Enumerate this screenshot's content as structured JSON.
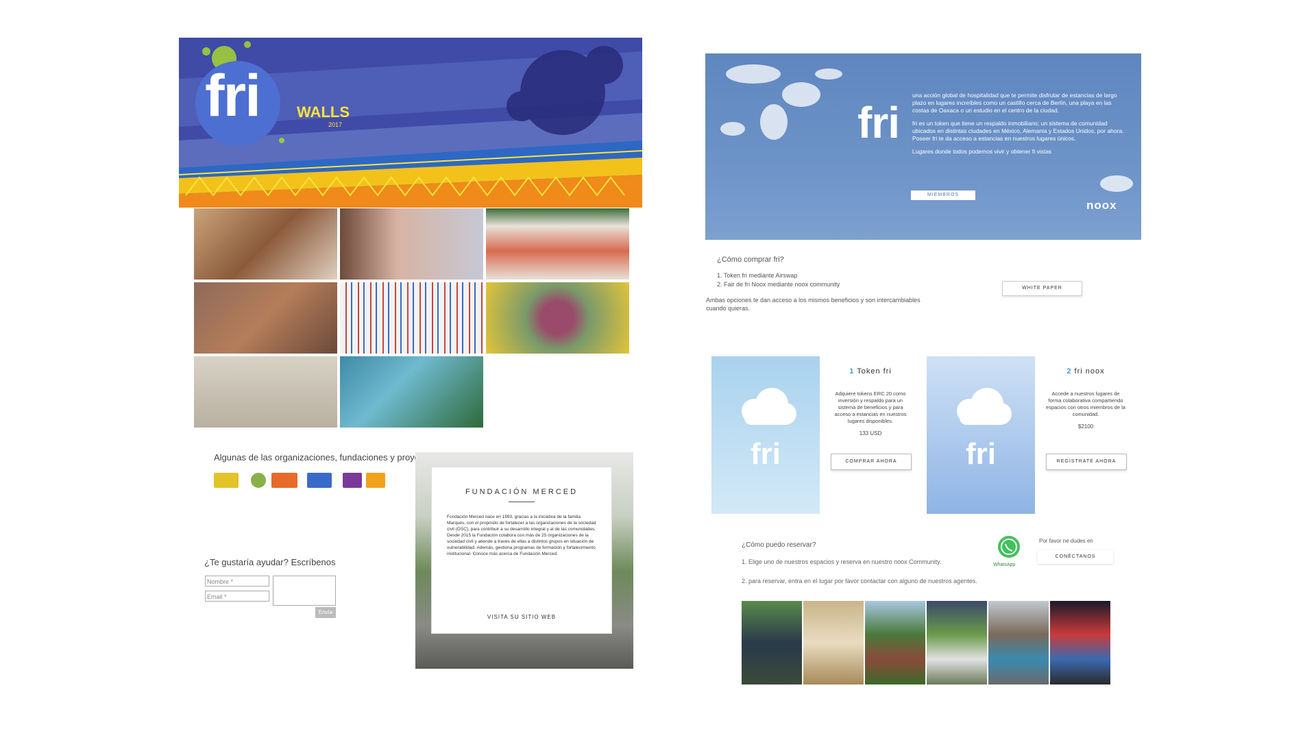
{
  "left": {
    "banner": {
      "logo": "fri",
      "title": "WALLS",
      "year": "2017"
    },
    "orgs_title": "Algunas de las organizaciones, fundaciones y proyectos",
    "help_title": "¿Te gustaría ayudar? Escríbenos",
    "form": {
      "name_placeholder": "Nombre *",
      "email_placeholder": "Email *",
      "send_label": "Envía"
    },
    "foundation": {
      "title": "FUNDACIÓN MERCED",
      "body": "Fundación Merced nace en 1993, gracias a la iniciativa de la familia Marqués, con el propósito de fortalecer a las organizaciones de la sociedad civil (OSC), para contribuir a su desarrollo integral y al de las comunidades. Desde 2015 la Fundación colabora con más de 25 organizaciones de la sociedad civil y atiende a través de ellas a distintos grupos en situación de vulnerabilidad. Además, gestiona programas de formación y fortalecimiento institucional. Conoce más acerca de Fundación Merced.",
      "link": "VISITA SU SITIO WEB"
    }
  },
  "right": {
    "hero": {
      "logo": "fri",
      "p1": "una acción global de hospitalidad que te permite disfrutar de estancias de largo plazo en lugares increíbles como un castillo cerca de Berlín, una playa en las costas de Oaxaca o un estudio en el centro de la ciudad.",
      "p2": "fri es un token que tiene un respaldo inmobiliario; un sistema de comunidad ubicados en distintas ciudades en México, Alemania y Estados Unidos, por ahora. Poseer fri te da acceso a estancias en nuestros lugares únicos.",
      "p3": "Lugares donde todos podemos vivir y obtener fi vistas",
      "members_btn": "MIEMBROS",
      "brand": "noox"
    },
    "buy": {
      "title": "¿Cómo comprar fri?",
      "step1": "1. Token fri mediante Airswap",
      "step2": "2. Fair de fri Noox mediante noox community",
      "note": "Ambas opciones te dan acceso a los mismos beneficios y son intercambiables cuando quieras.",
      "whitepaper_btn": "WHITE PAPER"
    },
    "offers": [
      {
        "num": "1",
        "name": "Token fri",
        "body": "Adquiere tokens ERC 20 como inversión y respaldo para un sistema de beneficios y para acceso a estancias en nuestros lugares disponibles.",
        "price": "133 USD",
        "btn": "COMPRAR AHORA",
        "card_logo": "fri"
      },
      {
        "num": "2",
        "name": "fri noox",
        "body": "Accede a nuestros lugares de forma colaborativa compartiendo espacios con otros miembros de la comunidad.",
        "price": "$2100",
        "btn": "REGISTRATE AHORA",
        "card_logo": "fri"
      }
    ],
    "reserve": {
      "title": "¿Cómo puedo reservar?",
      "line1": "1. Elige uno de nuestros espacios y reserva en nuestro noox Community.",
      "line2": "2. para reservar, entra en el lugar por favor contactar con alguno de nuestros agentes.",
      "whatsapp_label": "WhatsApp",
      "contact_text": "Por favor ne dudes en",
      "connect_btn": "CONÉCTANOS"
    }
  },
  "colors": {
    "banner_blue": "#3f4ba6",
    "accent_yellow": "#ffe33a",
    "sky_blue": "#6d93c8",
    "link_blue": "#39a0d6"
  }
}
